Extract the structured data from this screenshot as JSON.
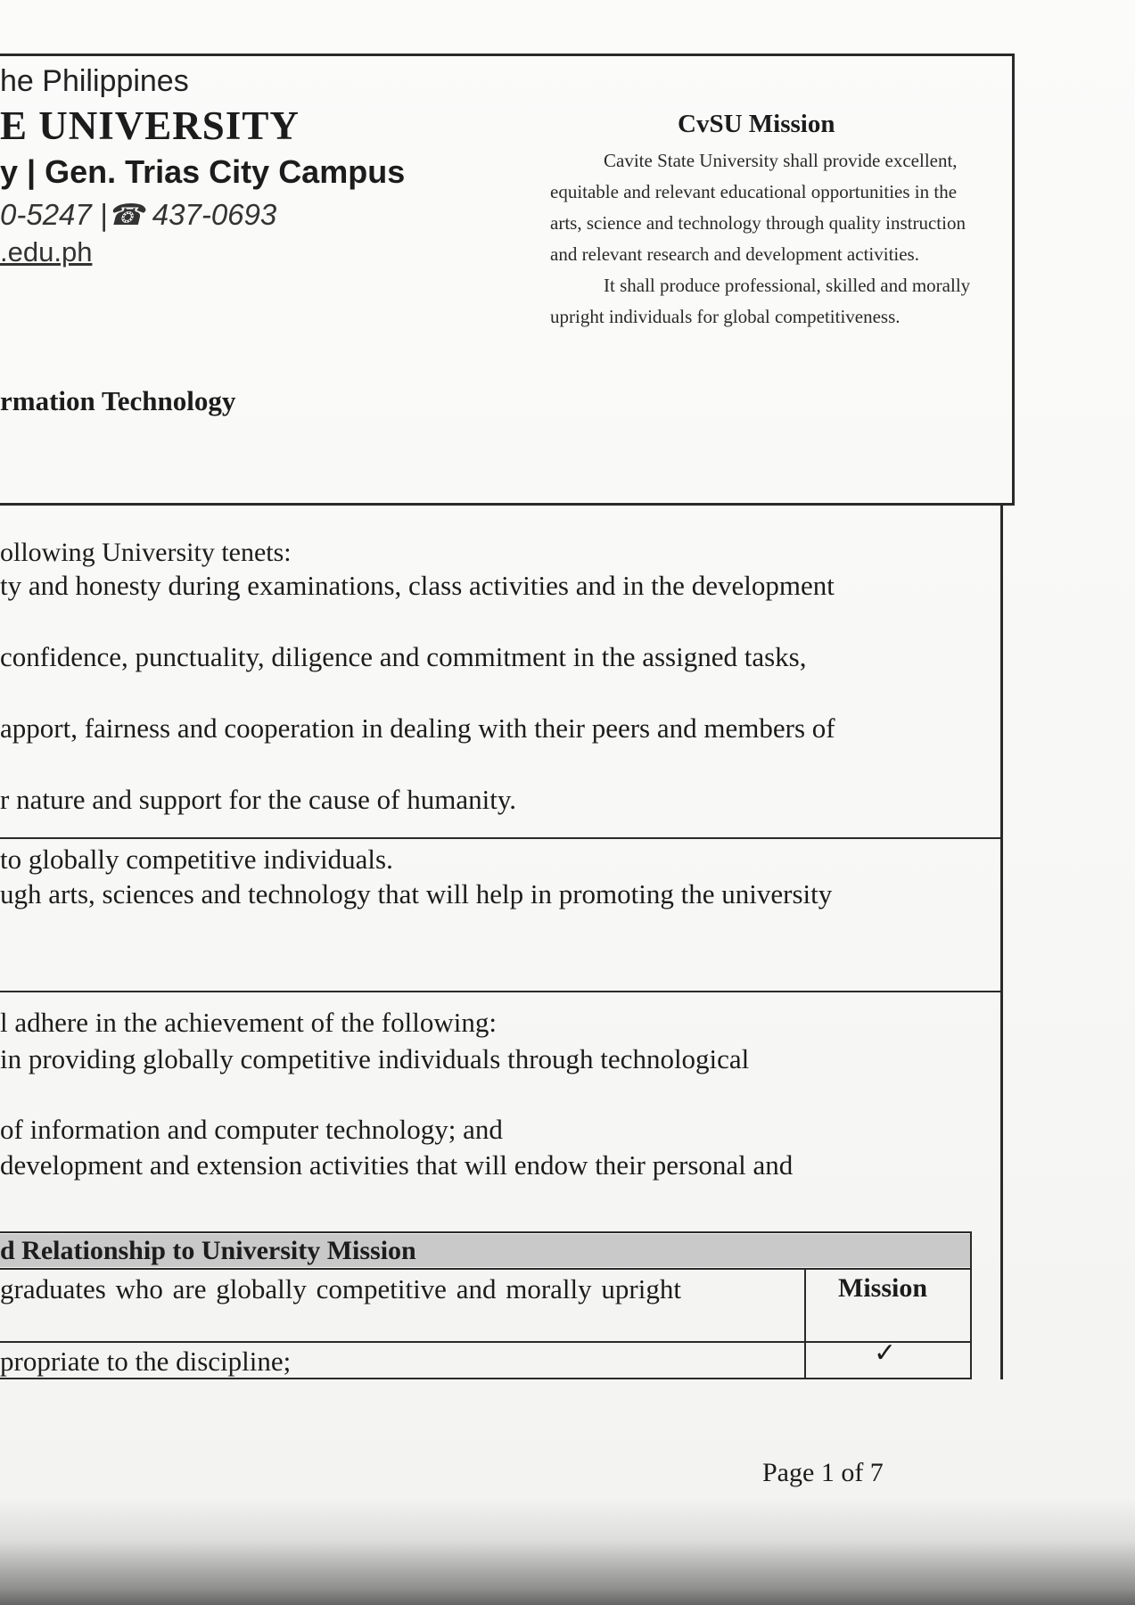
{
  "header": {
    "country": "he Philippines",
    "university": "E UNIVERSITY",
    "campus": "y | Gen. Trias City Campus",
    "phone": "0-5247 |☎ 437-0693",
    "website": ".edu.ph",
    "department": "rmation Technology"
  },
  "mission": {
    "title": "CvSU Mission",
    "paragraph1": "Cavite State University shall provide excellent, equitable and relevant educational opportunities in the arts, science and technology through quality instruction and relevant research and development activities.",
    "paragraph2": "It shall produce professional, skilled and morally upright individuals for global competitiveness."
  },
  "tenets": {
    "intro": "ollowing University  tenets:",
    "line1": "ty and honesty during examinations, class activities and in the development",
    "line2": "confidence, punctuality, diligence and commitment in the assigned tasks,",
    "line3": "apport, fairness and cooperation in dealing with their peers and members of",
    "line4": "r nature and support for the cause of humanity."
  },
  "goals": {
    "line1": "to globally competitive individuals.",
    "line2": "ugh arts, sciences and technology that will help in promoting the university"
  },
  "objectives": {
    "line1": "l adhere in the achievement of the following:",
    "line2": "in providing globally competitive individuals through technological",
    "line3": "of information and computer technology; and",
    "line4": "development and extension activities that will endow their personal and"
  },
  "relationship": {
    "title": "d Relationship to University Mission",
    "row1_text": "graduates  who  are  globally  competitive  and  morally  upright",
    "mission_header": "Mission",
    "row2_text": "propriate to the discipline;",
    "row2_check": "✓"
  },
  "footer": {
    "page": "Page 1 of 7"
  }
}
